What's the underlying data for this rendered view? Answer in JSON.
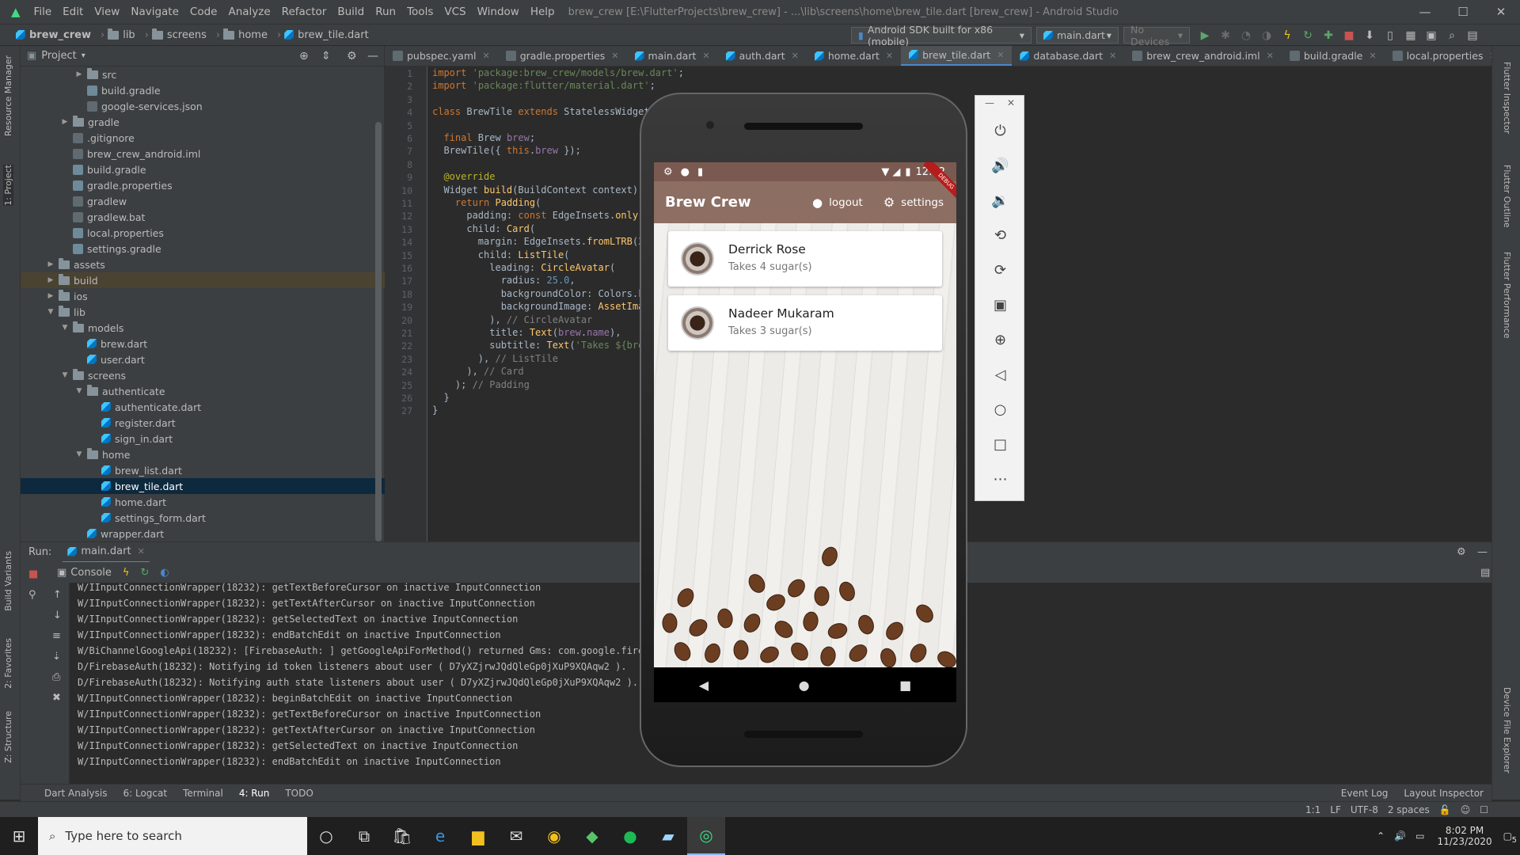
{
  "window": {
    "title": "brew_crew [E:\\FlutterProjects\\brew_crew] - ...\\lib\\screens\\home\\brew_tile.dart [brew_crew] - Android Studio",
    "menu": [
      "File",
      "Edit",
      "View",
      "Navigate",
      "Code",
      "Analyze",
      "Refactor",
      "Build",
      "Run",
      "Tools",
      "VCS",
      "Window",
      "Help"
    ],
    "controls": [
      "—",
      "☐",
      "✕"
    ]
  },
  "navbar": {
    "breadcrumbs": [
      "brew_crew",
      "lib",
      "screens",
      "home",
      "brew_tile.dart"
    ],
    "device_selector": "Android SDK built for x86 (mobile)",
    "run_config": "main.dart",
    "devices": "No Devices"
  },
  "left_strip": {
    "tabs": [
      "Resource Manager",
      "1: Project",
      "Build Variants",
      "2: Favorites",
      "Z: Structure"
    ]
  },
  "project_panel": {
    "title": "Project",
    "tree": [
      {
        "label": "src",
        "type": "folder",
        "arrow": "▶",
        "depth": 3
      },
      {
        "label": "build.gradle",
        "type": "gradle",
        "arrow": "",
        "depth": 3
      },
      {
        "label": "google-services.json",
        "type": "file",
        "arrow": "",
        "depth": 3
      },
      {
        "label": "gradle",
        "type": "folder",
        "arrow": "▶",
        "depth": 2
      },
      {
        "label": ".gitignore",
        "type": "file",
        "arrow": "",
        "depth": 2
      },
      {
        "label": "brew_crew_android.iml",
        "type": "file",
        "arrow": "",
        "depth": 2
      },
      {
        "label": "build.gradle",
        "type": "gradle",
        "arrow": "",
        "depth": 2
      },
      {
        "label": "gradle.properties",
        "type": "gradle",
        "arrow": "",
        "depth": 2
      },
      {
        "label": "gradlew",
        "type": "file",
        "arrow": "",
        "depth": 2
      },
      {
        "label": "gradlew.bat",
        "type": "file",
        "arrow": "",
        "depth": 2
      },
      {
        "label": "local.properties",
        "type": "gradle",
        "arrow": "",
        "depth": 2
      },
      {
        "label": "settings.gradle",
        "type": "gradle",
        "arrow": "",
        "depth": 2
      },
      {
        "label": "assets",
        "type": "folder",
        "arrow": "▶",
        "depth": 1
      },
      {
        "label": "build",
        "type": "folder",
        "arrow": "▶",
        "depth": 1,
        "highlight": true
      },
      {
        "label": "ios",
        "type": "folder",
        "arrow": "▶",
        "depth": 1
      },
      {
        "label": "lib",
        "type": "folder",
        "arrow": "▼",
        "depth": 1
      },
      {
        "label": "models",
        "type": "folder",
        "arrow": "▼",
        "depth": 2
      },
      {
        "label": "brew.dart",
        "type": "dart",
        "arrow": "",
        "depth": 3
      },
      {
        "label": "user.dart",
        "type": "dart",
        "arrow": "",
        "depth": 3
      },
      {
        "label": "screens",
        "type": "folder",
        "arrow": "▼",
        "depth": 2
      },
      {
        "label": "authenticate",
        "type": "folder",
        "arrow": "▼",
        "depth": 3
      },
      {
        "label": "authenticate.dart",
        "type": "dart",
        "arrow": "",
        "depth": 4
      },
      {
        "label": "register.dart",
        "type": "dart",
        "arrow": "",
        "depth": 4
      },
      {
        "label": "sign_in.dart",
        "type": "dart",
        "arrow": "",
        "depth": 4
      },
      {
        "label": "home",
        "type": "folder",
        "arrow": "▼",
        "depth": 3
      },
      {
        "label": "brew_list.dart",
        "type": "dart",
        "arrow": "",
        "depth": 4
      },
      {
        "label": "brew_tile.dart",
        "type": "dart",
        "arrow": "",
        "depth": 4,
        "selected": true
      },
      {
        "label": "home.dart",
        "type": "dart",
        "arrow": "",
        "depth": 4
      },
      {
        "label": "settings_form.dart",
        "type": "dart",
        "arrow": "",
        "depth": 4
      },
      {
        "label": "wrapper.dart",
        "type": "dart",
        "arrow": "",
        "depth": 3
      }
    ]
  },
  "editor": {
    "tabs": [
      {
        "label": "pubspec.yaml",
        "active": false
      },
      {
        "label": "gradle.properties",
        "active": false
      },
      {
        "label": "main.dart",
        "active": false
      },
      {
        "label": "auth.dart",
        "active": false
      },
      {
        "label": "home.dart",
        "active": false
      },
      {
        "label": "brew_tile.dart",
        "active": true
      },
      {
        "label": "database.dart",
        "active": false
      },
      {
        "label": "brew_crew_android.iml",
        "active": false
      },
      {
        "label": "build.gradle",
        "active": false
      },
      {
        "label": "local.properties",
        "active": false
      }
    ],
    "lines": [
      "<span class='kw'>import</span> <span class='str'>'package:brew_crew/models/brew.dart'</span>;",
      "<span class='kw'>import</span> <span class='str'>'package:flutter/material.dart'</span>;",
      "",
      "<span class='kw'>class</span> BrewTile <span class='kw'>extends</span> StatelessWidget {",
      "",
      "  <span class='kw'>final</span> Brew <span class='fld'>brew</span>;",
      "  BrewTile({ <span class='kw'>this</span>.<span class='fld'>brew</span> });",
      "",
      "  <span class='ann'>@override</span>",
      "  Widget <span class='cls'>build</span>(BuildContext context) {",
      "    <span class='kw'>return</span> <span class='cls'>Padding</span>(",
      "      padding: <span class='kw'>const</span> EdgeInsets.<span class='cls'>only</span>(t",
      "      child: <span class='cls'>Card</span>(",
      "        margin: EdgeInsets.<span class='cls'>fromLTRB</span>(<span class='num'>20</span>",
      "        child: <span class='cls'>ListTile</span>(",
      "          leading: <span class='cls'>CircleAvatar</span>(",
      "            radius: <span class='num'>25.0</span>,",
      "            backgroundColor: Colors.<span class='fld'>br</span>",
      "            backgroundImage: <span class='cls'>AssetImag</span>",
      "          ), <span class='cmt'>// CircleAvatar</span>",
      "          title: <span class='cls'>Text</span>(<span class='fld'>brew</span>.<span class='fld'>name</span>),",
      "          subtitle: <span class='cls'>Text</span>(<span class='str'>'Takes ${brew</span>",
      "        ), <span class='cmt'>// ListTile</span>",
      "      ), <span class='cmt'>// Card</span>",
      "    ); <span class='cmt'>// Padding</span>",
      "  }",
      "}"
    ]
  },
  "run_panel": {
    "label": "Run:",
    "config_tab": "main.dart",
    "console_tab": "Console",
    "log": [
      "W/IInputConnectionWrapper(18232): getTextBeforeCursor on inactive InputConnection",
      "W/IInputConnectionWrapper(18232): getTextAfterCursor on inactive InputConnection",
      "W/IInputConnectionWrapper(18232): getSelectedText on inactive InputConnection",
      "W/IInputConnectionWrapper(18232): endBatchEdit on inactive InputConnection",
      "W/BiChannelGoogleApi(18232): [FirebaseAuth: ] getGoogleApiForMethod() returned Gms: com.google.firebas",
      "D/FirebaseAuth(18232): Notifying id token listeners about user ( D7yXZjrwJQdQleGp0jXuP9XQAqw2 ).",
      "D/FirebaseAuth(18232): Notifying auth state listeners about user ( D7yXZjrwJQdQleGp0jXuP9XQAqw2 ).",
      "W/IInputConnectionWrapper(18232): beginBatchEdit on inactive InputConnection",
      "W/IInputConnectionWrapper(18232): getTextBeforeCursor on inactive InputConnection",
      "W/IInputConnectionWrapper(18232): getTextAfterCursor on inactive InputConnection",
      "W/IInputConnectionWrapper(18232): getSelectedText on inactive InputConnection",
      "W/IInputConnectionWrapper(18232): endBatchEdit on inactive InputConnection"
    ]
  },
  "tool_tabs": [
    "Dart Analysis",
    "6: Logcat",
    "Terminal",
    "4: Run",
    "TODO"
  ],
  "status_bar": {
    "event_log": "Event Log",
    "layout_inspector": "Layout Inspector",
    "position": "1:1",
    "line_sep": "LF",
    "encoding": "UTF-8",
    "indent": "2 spaces"
  },
  "right_strip": {
    "tabs": [
      "Flutter Inspector",
      "Flutter Outline",
      "Flutter Performance",
      "Device File Explorer"
    ]
  },
  "emulator": {
    "status_time": "12:02",
    "app_title": "Brew Crew",
    "logout_label": "logout",
    "settings_label": "settings",
    "debug_ribbon": "DEBUG",
    "brews": [
      {
        "name": "Derrick Rose",
        "subtitle": "Takes 4 sugar(s)"
      },
      {
        "name": "Nadeer Mukaram",
        "subtitle": "Takes 3 sugar(s)"
      }
    ]
  },
  "taskbar": {
    "search_placeholder": "Type here to search",
    "time": "8:02 PM",
    "date": "11/23/2020",
    "notifications": "5"
  }
}
